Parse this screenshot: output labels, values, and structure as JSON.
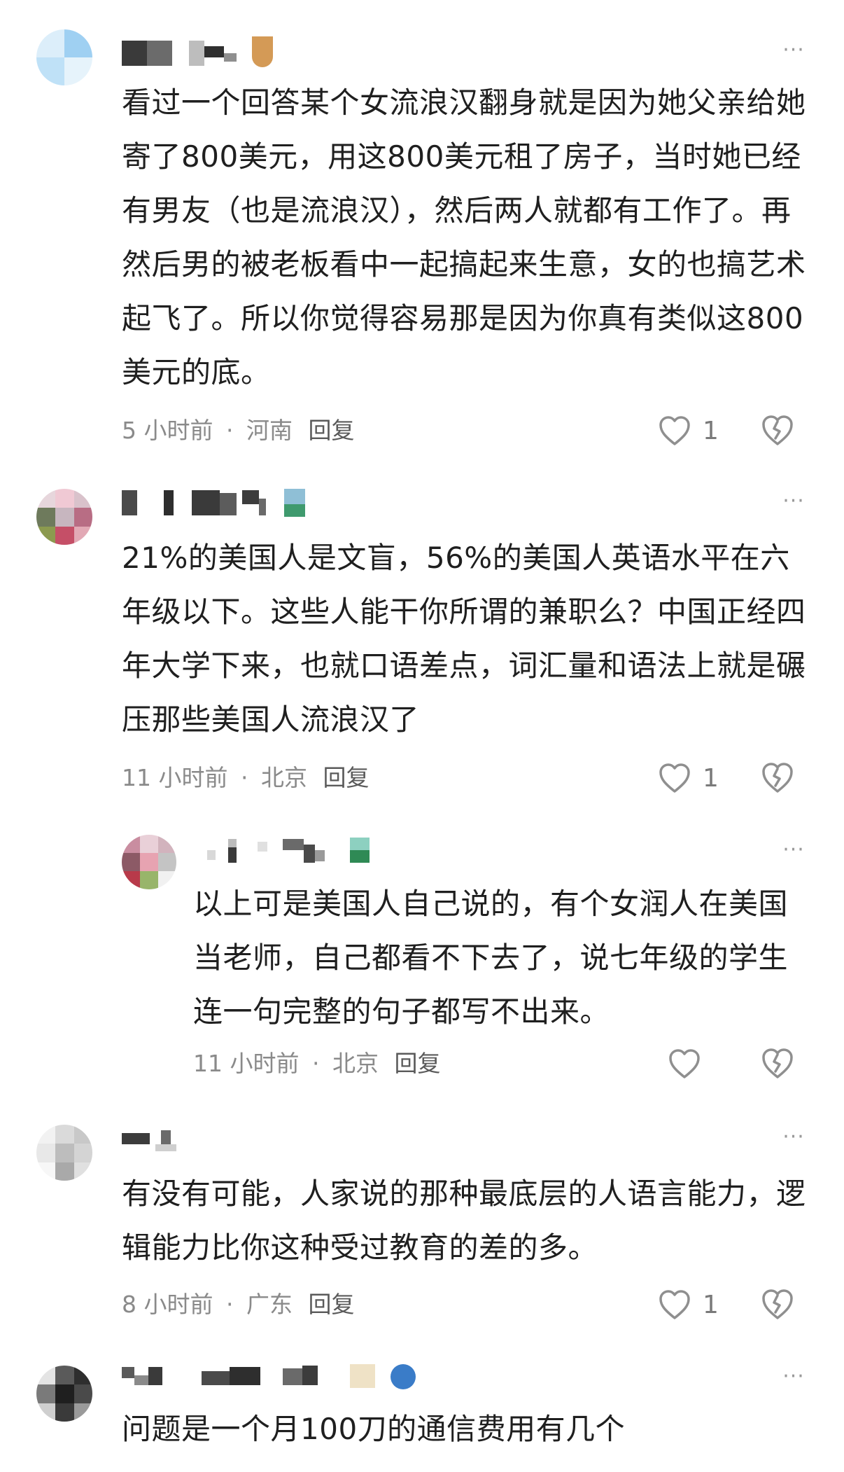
{
  "comments": [
    {
      "text": "看过一个回答某个女流浪汉翻身就是因为她父亲给她寄了800美元，用这800美元租了房子，当时她已经有男友（也是流浪汉），然后两人就都有工作了。再然后男的被老板看中一起搞起来生意，女的也搞艺术起飞了。所以你觉得容易那是因为你真有类似这800美元的底。",
      "time": "5 小时前",
      "location": "河南",
      "reply": "回复",
      "likes": "1"
    },
    {
      "text": "21%的美国人是文盲，56%的美国人英语水平在六年级以下。这些人能干你所谓的兼职么？中国正经四年大学下来，也就口语差点，词汇量和语法上就是碾压那些美国人流浪汉了",
      "time": "11 小时前",
      "location": "北京",
      "reply": "回复",
      "likes": "1"
    },
    {
      "text": "以上可是美国人自己说的，有个女润人在美国当老师，自己都看不下去了，说七年级的学生连一句完整的句子都写不出来。",
      "time": "11 小时前",
      "location": "北京",
      "reply": "回复",
      "likes": ""
    },
    {
      "text": "有没有可能，人家说的那种最底层的人语言能力，逻辑能力比你这种受过教育的差的多。",
      "time": "8 小时前",
      "location": "广东",
      "reply": "回复",
      "likes": "1"
    },
    {
      "text": "问题是一个月100刀的通信费用有几个",
      "time": "",
      "location": "",
      "reply": "",
      "likes": ""
    }
  ],
  "more_label": "···",
  "sep": "·",
  "icons": {
    "like": "heart-outline-icon",
    "dislike": "broken-heart-icon",
    "more": "more-dots-icon"
  },
  "colors": {
    "text": "#1f1f1f",
    "meta": "#8a8a8a",
    "icon": "#8f8f8f"
  }
}
